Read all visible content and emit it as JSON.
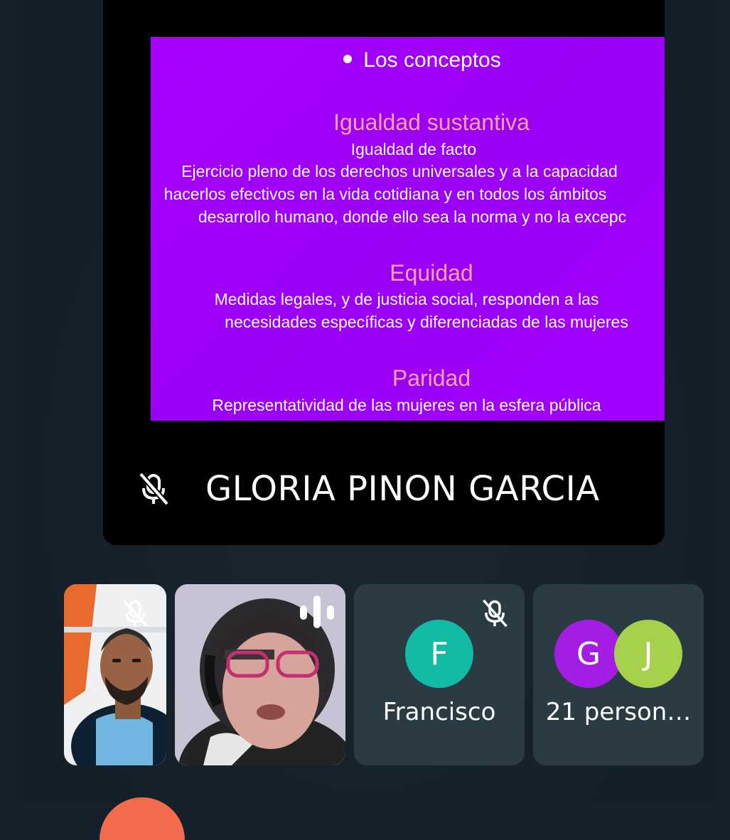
{
  "slide": {
    "bullet_title": "Los conceptos",
    "sections": [
      {
        "heading": "Igualdad sustantiva",
        "lines": [
          "Igualdad de facto",
          "Ejercicio pleno de los derechos universales y a la capacidad",
          "hacerlos efectivos en la vida cotidiana y en todos los ámbitos",
          "desarrollo humano, donde ello sea la norma y no la excepc"
        ]
      },
      {
        "heading": "Equidad",
        "lines": [
          "Medidas legales, y de justicia social, responden a las",
          "necesidades específicas y diferenciadas de las mujeres"
        ]
      },
      {
        "heading": "Paridad",
        "lines": [
          "Representatividad de las mujeres en la esfera pública"
        ]
      }
    ],
    "background_color": "#a600ff",
    "heading_color": "#f4a49a"
  },
  "presenter": {
    "name": "GLORIA PINON GARCIA",
    "mic_icon": "mic-off-icon"
  },
  "participants": {
    "francisco": {
      "initial": "F",
      "name": "Francisco",
      "avatar_color": "#13bba6",
      "mic_icon": "mic-off-icon"
    },
    "others": {
      "initials": [
        "G",
        "J"
      ],
      "avatar_colors": [
        "#a41de3",
        "#a5d24a"
      ],
      "label": "21 person…"
    }
  }
}
